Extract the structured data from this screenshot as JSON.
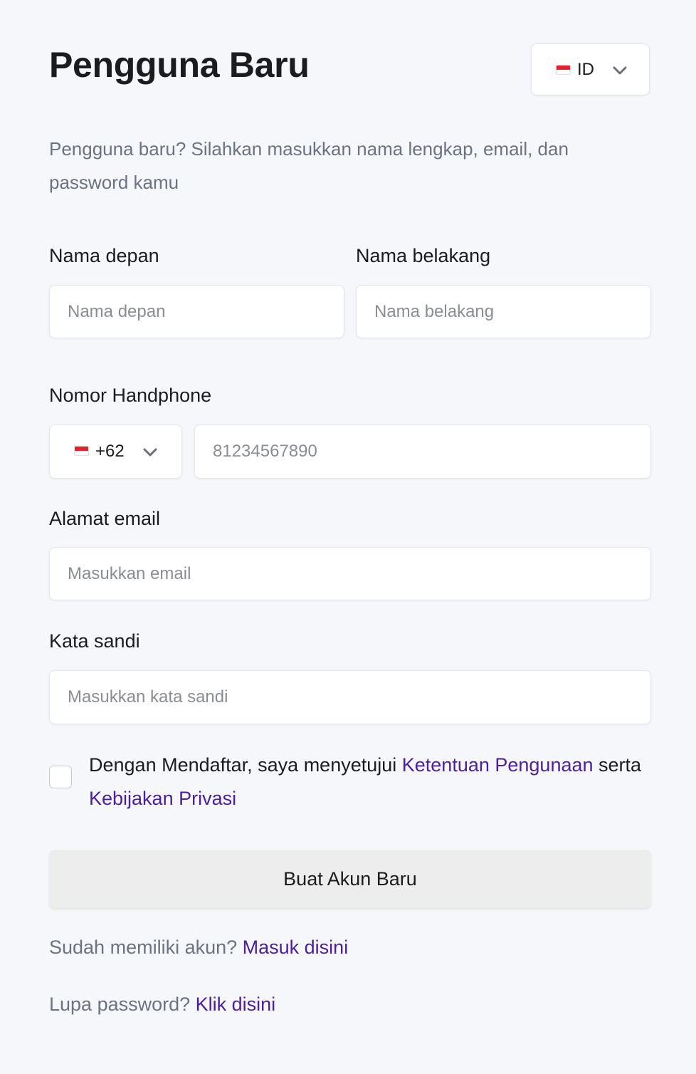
{
  "header": {
    "title": "Pengguna Baru",
    "language": {
      "code": "ID",
      "flag_icon": "indonesia-flag-icon"
    }
  },
  "subtitle": "Pengguna baru? Silahkan masukkan nama lengkap, email, dan password kamu",
  "form": {
    "first_name": {
      "label": "Nama depan",
      "placeholder": "Nama depan",
      "value": ""
    },
    "last_name": {
      "label": "Nama belakang",
      "placeholder": "Nama belakang",
      "value": ""
    },
    "phone": {
      "label": "Nomor Handphone",
      "country_code": "+62",
      "flag_icon": "indonesia-flag-icon",
      "placeholder": "81234567890",
      "value": ""
    },
    "email": {
      "label": "Alamat email",
      "placeholder": "Masukkan email",
      "value": ""
    },
    "password": {
      "label": "Kata sandi",
      "placeholder": "Masukkan kata sandi",
      "value": ""
    },
    "terms": {
      "checked": false,
      "prefix": "Dengan Mendaftar, saya menyetujui ",
      "terms_link": "Ketentuan Pengunaan",
      "middle": " serta ",
      "privacy_link": "Kebijakan Privasi"
    },
    "submit_label": "Buat Akun Baru"
  },
  "footer": {
    "login_prompt": "Sudah memiliki akun? ",
    "login_link": "Masuk disini",
    "forgot_prompt": "Lupa password? ",
    "forgot_link": "Klik disini"
  },
  "colors": {
    "background": "#f6f7fb",
    "link": "#4b1f9e",
    "muted_text": "#6b7280",
    "button_bg": "#ededee"
  }
}
